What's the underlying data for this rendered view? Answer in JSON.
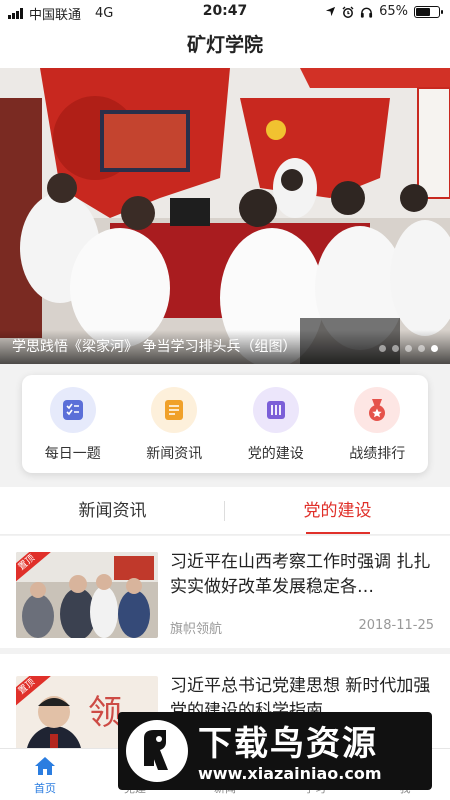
{
  "status_bar": {
    "carrier": "中国联通",
    "network": "4G",
    "time": "20:47",
    "battery_text": "65%",
    "battery_level": 0.65
  },
  "header": {
    "title": "矿灯学院"
  },
  "banner": {
    "caption": "学思践悟《梁家河》 争当学习排头兵（组图）",
    "slide_count": 5,
    "active_slide": 5
  },
  "quick_actions": [
    {
      "label": "每日一题",
      "icon": "checklist-icon",
      "color": "#5b6fd8",
      "bg": "#e6eafb"
    },
    {
      "label": "新闻资讯",
      "icon": "news-icon",
      "color": "#f0a12a",
      "bg": "#fdf0db"
    },
    {
      "label": "党的建设",
      "icon": "book-icon",
      "color": "#7b5fd8",
      "bg": "#ece6fb"
    },
    {
      "label": "战绩排行",
      "icon": "medal-icon",
      "color": "#e5534b",
      "bg": "#fde6e4"
    }
  ],
  "tabs": [
    {
      "label": "新闻资讯",
      "active": false
    },
    {
      "label": "党的建设",
      "active": true
    }
  ],
  "news": [
    {
      "tag": "置顶",
      "title": "习近平在山西考察工作时强调 扎扎实实做好改革发展稳定各…",
      "source": "旗帜领航",
      "date": "2018-11-25"
    },
    {
      "tag": "置顶",
      "title": "习近平总书记党建思想 新时代加强党的建设的科学指南",
      "source": "",
      "date": ""
    }
  ],
  "tab_bar": [
    {
      "label": "首页",
      "icon": "home-icon",
      "active": true
    },
    {
      "label": "党建",
      "icon": "flag-icon",
      "active": false
    },
    {
      "label": "新闻",
      "icon": "news-icon",
      "active": false
    },
    {
      "label": "学习",
      "icon": "study-icon",
      "active": false
    },
    {
      "label": "我",
      "icon": "user-icon",
      "active": false
    }
  ],
  "watermark": {
    "title": "下载鸟资源",
    "url": "www.xiazainiao.com"
  },
  "colors": {
    "accent": "#e0302a",
    "tab_active": "#2b7de0"
  }
}
